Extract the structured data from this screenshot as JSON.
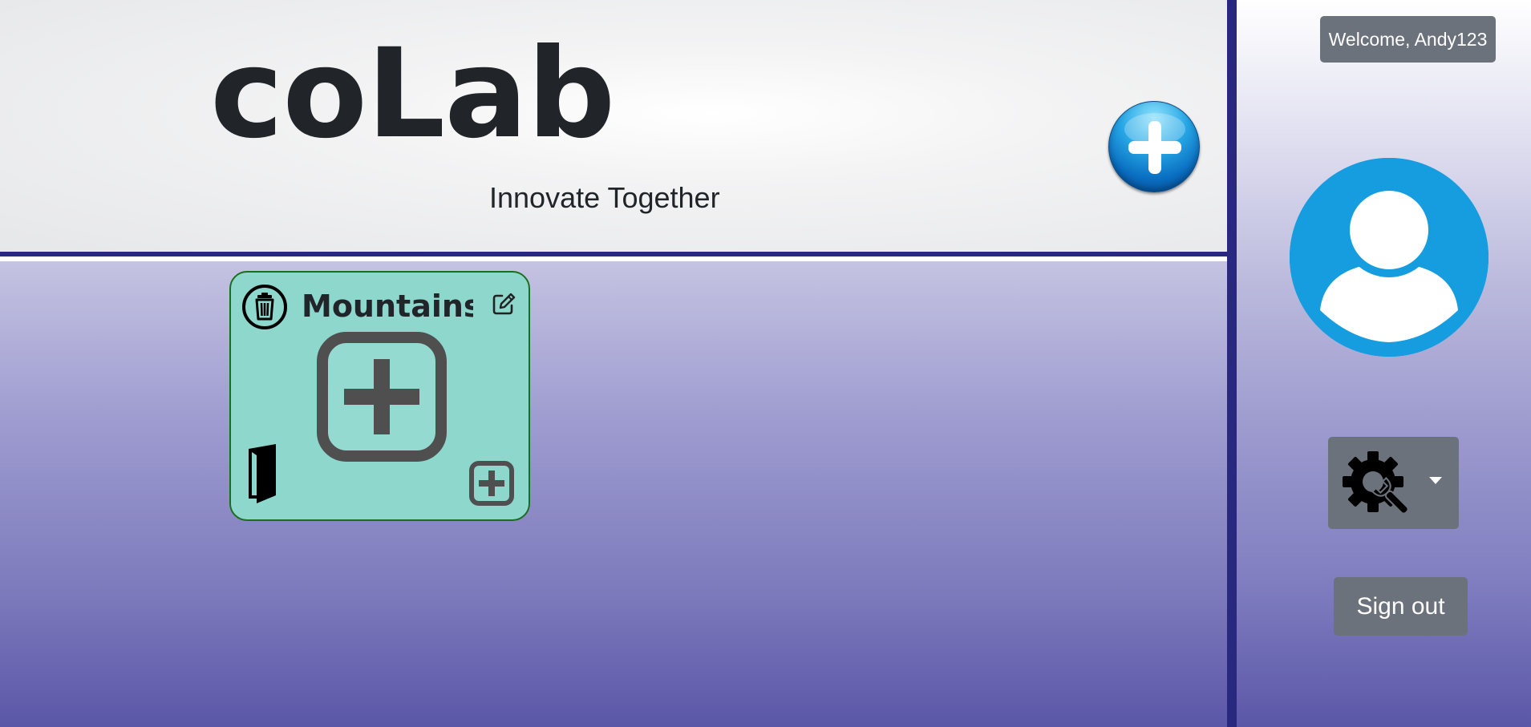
{
  "header": {
    "title": "coLab",
    "tagline": "Innovate Together",
    "add_project_icon": "add-circle-icon"
  },
  "projects": [
    {
      "name": "Mountains",
      "color": "#8dd7cd",
      "border_color": "#1b6e1b",
      "icons": [
        "trash-icon",
        "edit-icon",
        "add-square-icon",
        "door-icon",
        "add-square-icon"
      ]
    }
  ],
  "sidebar": {
    "welcome_text": "Welcome, Andy123",
    "avatar_icon": "user-avatar-icon",
    "settings_icon": "gear-wrench-icon",
    "signout_label": "Sign out"
  },
  "colors": {
    "header_border": "#28287e",
    "button_gray": "#6c727b",
    "avatar_blue": "#159de0",
    "text_dark": "#212529"
  }
}
